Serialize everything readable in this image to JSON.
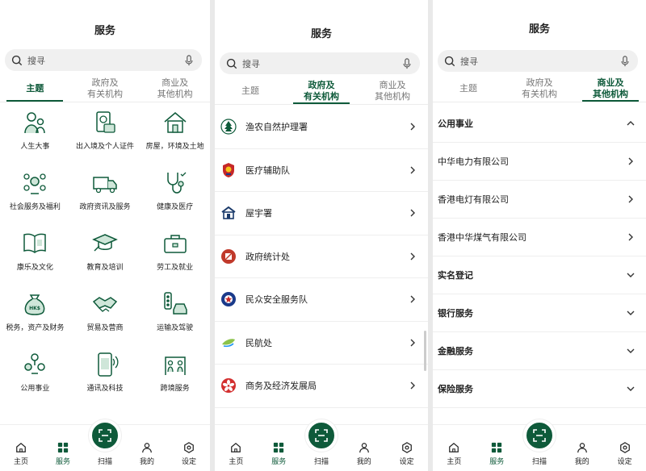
{
  "colors": {
    "accent": "#0e5a3a",
    "bg": "#ffffff"
  },
  "panel1": {
    "title": "服务",
    "search_placeholder": "搜寻",
    "tabs": [
      {
        "line1": "主题",
        "line2": ""
      },
      {
        "line1": "政府及",
        "line2": "有关机构"
      },
      {
        "line1": "商业及",
        "line2": "其他机构"
      }
    ],
    "active_tab": 0,
    "topics": [
      {
        "label": "人生大事",
        "icon": "family-icon"
      },
      {
        "label": "出入境及个人证件",
        "icon": "passport-icon"
      },
      {
        "label": "房屋，环境及土地",
        "icon": "house-icon"
      },
      {
        "label": "社会服务及福利",
        "icon": "welfare-icon"
      },
      {
        "label": "政府资讯及服务",
        "icon": "truck-icon"
      },
      {
        "label": "健康及医疗",
        "icon": "stethoscope-icon"
      },
      {
        "label": "康乐及文化",
        "icon": "book-icon"
      },
      {
        "label": "教育及培训",
        "icon": "graduation-icon"
      },
      {
        "label": "劳工及就业",
        "icon": "briefcase-icon"
      },
      {
        "label": "税务，资产及财务",
        "icon": "money-bag-icon"
      },
      {
        "label": "贸易及营商",
        "icon": "handshake-icon"
      },
      {
        "label": "运输及驾驶",
        "icon": "traffic-icon"
      },
      {
        "label": "公用事业",
        "icon": "utilities-icon"
      },
      {
        "label": "通讯及科技",
        "icon": "phone-icon"
      },
      {
        "label": "跨境服务",
        "icon": "border-icon"
      }
    ]
  },
  "panel2": {
    "title": "服务",
    "search_placeholder": "搜寻",
    "tabs": [
      {
        "line1": "主题",
        "line2": ""
      },
      {
        "line1": "政府及",
        "line2": "有关机构"
      },
      {
        "line1": "商业及",
        "line2": "其他机构"
      }
    ],
    "active_tab": 1,
    "departments": [
      {
        "label": "渔农自然护理署",
        "icon": "tree-logo-icon"
      },
      {
        "label": "医疗辅助队",
        "icon": "badge-logo-icon"
      },
      {
        "label": "屋宇署",
        "icon": "building-logo-icon"
      },
      {
        "label": "政府统计处",
        "icon": "stats-logo-icon"
      },
      {
        "label": "民众安全服务队",
        "icon": "shield-logo-icon"
      },
      {
        "label": "民航处",
        "icon": "aviation-logo-icon"
      },
      {
        "label": "商务及经济发展局",
        "icon": "bauhinia-logo-icon"
      }
    ]
  },
  "panel3": {
    "title": "服务",
    "search_placeholder": "搜寻",
    "tabs": [
      {
        "line1": "主题",
        "line2": ""
      },
      {
        "line1": "政府及",
        "line2": "有关机构"
      },
      {
        "line1": "商业及",
        "line2": "其他机构"
      }
    ],
    "active_tab": 2,
    "categories": [
      {
        "label": "公用事业",
        "type": "section-open"
      },
      {
        "label": "中华电力有限公司",
        "type": "item"
      },
      {
        "label": "香港电灯有限公司",
        "type": "item"
      },
      {
        "label": "香港中华煤气有限公司",
        "type": "item"
      },
      {
        "label": "实名登记",
        "type": "section"
      },
      {
        "label": "银行服务",
        "type": "section"
      },
      {
        "label": "金融服务",
        "type": "section"
      },
      {
        "label": "保险服务",
        "type": "section"
      }
    ]
  },
  "nav": [
    {
      "label": "主页",
      "icon": "home-icon"
    },
    {
      "label": "服务",
      "icon": "grid-icon"
    },
    {
      "label": "扫描",
      "icon": "scan-icon"
    },
    {
      "label": "我的",
      "icon": "user-icon"
    },
    {
      "label": "设定",
      "icon": "settings-icon"
    }
  ]
}
